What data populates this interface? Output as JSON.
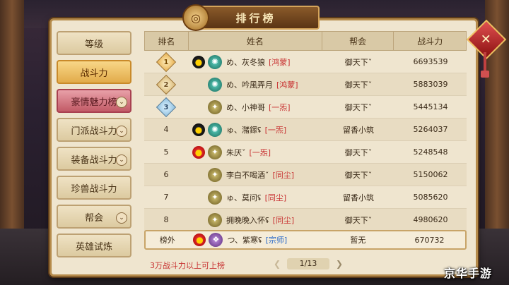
{
  "window": {
    "title": "排行榜"
  },
  "tabs": [
    {
      "label": "等级",
      "state": "normal",
      "dropdown": false
    },
    {
      "label": "战斗力",
      "state": "active",
      "dropdown": false
    },
    {
      "label": "豪情魅力榜",
      "state": "special",
      "dropdown": true
    },
    {
      "label": "门派战斗力",
      "state": "normal",
      "dropdown": true
    },
    {
      "label": "装备战斗力",
      "state": "normal",
      "dropdown": true
    },
    {
      "label": "珍兽战斗力",
      "state": "normal",
      "dropdown": false
    },
    {
      "label": "帮会",
      "state": "normal",
      "dropdown": true
    },
    {
      "label": "英雄试炼",
      "state": "normal",
      "dropdown": false
    }
  ],
  "table": {
    "headers": [
      "排名",
      "姓名",
      "帮会",
      "战斗力"
    ],
    "rows": [
      {
        "rank": "1",
        "badge": "gold",
        "qq": "black",
        "school": "teal",
        "name": "め、灰冬狼",
        "tag": "[鸿蒙]",
        "guild": "御天下ˇ",
        "power": "6693539"
      },
      {
        "rank": "2",
        "badge": "silver",
        "qq": "none",
        "school": "teal",
        "name": "め、吟風弄月",
        "tag": "[鸿蒙]",
        "guild": "御天下ˇ",
        "power": "5883039"
      },
      {
        "rank": "3",
        "badge": "bronze",
        "qq": "none",
        "school": "olive",
        "name": "め、小神哥",
        "tag": "[一炁]",
        "guild": "御天下ˇ",
        "power": "5445134"
      },
      {
        "rank": "4",
        "badge": "",
        "qq": "black",
        "school": "teal",
        "name": "ゅ、潴䥂ʢ",
        "tag": "[一炁]",
        "guild": "留香小筑",
        "power": "5264037"
      },
      {
        "rank": "5",
        "badge": "",
        "qq": "red",
        "school": "olive",
        "name": "朱厌ˇ",
        "tag": "[一炁]",
        "guild": "御天下ˇ",
        "power": "5248548"
      },
      {
        "rank": "6",
        "badge": "",
        "qq": "none",
        "school": "olive",
        "name": "李白不喝酒ˇ",
        "tag": "[同尘]",
        "guild": "御天下ˇ",
        "power": "5150062"
      },
      {
        "rank": "7",
        "badge": "",
        "qq": "none",
        "school": "olive",
        "name": "ゅ、莫问ʢ",
        "tag": "[同尘]",
        "guild": "留香小筑",
        "power": "5085620"
      },
      {
        "rank": "8",
        "badge": "",
        "qq": "none",
        "school": "olive",
        "name": "拥晚晚入怀ʢ",
        "tag": "[同尘]",
        "guild": "御天下ˇ",
        "power": "4980620"
      }
    ]
  },
  "self_row": {
    "rank": "榜外",
    "qq": "red",
    "school": "purple",
    "name": "つ、紫寒ʢ",
    "tag": "[宗师]",
    "guild": "暂无",
    "power": "670732"
  },
  "footer": {
    "note": "3万战斗力以上可上榜",
    "page": "1/13"
  },
  "watermark": "京华手游",
  "colors": {
    "accent": "#e2ab4a",
    "tag_red": "#c83232",
    "tag_blue": "#2a6ac8",
    "panel": "#efe5cf"
  },
  "icons": {
    "close": "close-icon",
    "prev": "chevron-left-icon",
    "next": "chevron-right-icon"
  }
}
